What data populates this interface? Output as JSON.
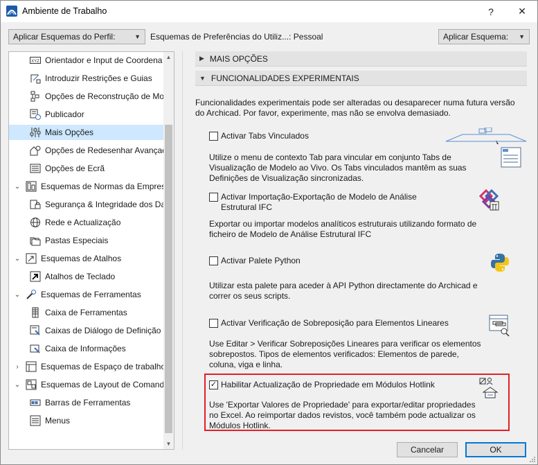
{
  "window": {
    "title": "Ambiente de Trabalho",
    "help_label": "?",
    "close_label": "✕"
  },
  "toolbar": {
    "apply_profile_label": "Aplicar Esquemas do Perfil:",
    "preference_schemes_label": "Esquemas de Preferências do Utiliz...:  Pessoal",
    "apply_scheme_label": "Aplicar Esquema:"
  },
  "tree": {
    "items": [
      {
        "label": "Orientador e Input de Coordena",
        "level": 2,
        "icon": "xyz-icon"
      },
      {
        "label": "Introduzir Restrições e Guias",
        "level": 2,
        "icon": "constraints-icon"
      },
      {
        "label": "Opções de Reconstrução de Mod",
        "level": 2,
        "icon": "rebuild-icon"
      },
      {
        "label": "Publicador",
        "level": 2,
        "icon": "publisher-icon"
      },
      {
        "label": "Mais Opções",
        "level": 2,
        "icon": "sliders-icon",
        "selected": true
      },
      {
        "label": "Opções de Redesenhar Avançada",
        "level": 2,
        "icon": "redraw-icon"
      },
      {
        "label": "Opções de Ecrã",
        "level": 2,
        "icon": "screen-icon"
      },
      {
        "label": "Esquemas de Normas da Empresa",
        "level": 1,
        "icon": "company-standards-icon",
        "expanded": true
      },
      {
        "label": "Segurança & Integridade dos Da",
        "level": 2,
        "icon": "security-icon"
      },
      {
        "label": "Rede e Actualização",
        "level": 2,
        "icon": "globe-icon"
      },
      {
        "label": "Pastas Especiais",
        "level": 2,
        "icon": "folders-icon"
      },
      {
        "label": "Esquemas de Atalhos",
        "level": 1,
        "icon": "shortcuts-icon",
        "expanded": true
      },
      {
        "label": "Atalhos de Teclado",
        "level": 2,
        "icon": "shortcut-arrow-icon"
      },
      {
        "label": "Esquemas de Ferramentas",
        "level": 1,
        "icon": "tools-icon",
        "expanded": true
      },
      {
        "label": "Caixa de Ferramentas",
        "level": 2,
        "icon": "toolbox-icon"
      },
      {
        "label": "Caixas de Diálogo de Definição d",
        "level": 2,
        "icon": "settings-dialog-icon"
      },
      {
        "label": "Caixa de Informações",
        "level": 2,
        "icon": "info-box-icon"
      },
      {
        "label": "Esquemas de Espaço de trabalho",
        "level": 1,
        "icon": "workspace-icon",
        "expanded": false
      },
      {
        "label": "Esquemas de Layout de Comandos",
        "level": 1,
        "icon": "command-layout-icon",
        "expanded": true
      },
      {
        "label": "Barras de Ferramentas",
        "level": 2,
        "icon": "toolbars-icon"
      },
      {
        "label": "Menus",
        "level": 2,
        "icon": "menus-icon"
      }
    ]
  },
  "sections": {
    "more_options": "MAIS OPÇÕES",
    "experimental": "FUNCIONALIDADES EXPERIMENTAIS"
  },
  "intro": "Funcionalidades experimentais pode ser alteradas ou desaparecer numa futura versão do Archicad. Por favor, experimente, mas não se envolva demasiado.",
  "features": [
    {
      "label": "Activar Tabs Vinculados",
      "checked": false,
      "description": "Utilize o menu de contexto Tab para vincular em conjunto Tabs de Visualização de Modelo ao Vivo. Os Tabs vinculados mantêm as suas Definições de Visualização sincronizadas.",
      "icon": "linked-tabs-icon"
    },
    {
      "label": "Activar Importação-Exportação de Modelo de Análise Estrutural IFC",
      "checked": false,
      "description": "Exportar ou importar modelos analíticos estruturais utilizando formato de ficheiro de Modelo de Análise Estrutural IFC",
      "icon": "ifc-structural-icon"
    },
    {
      "label": "Activar Palete Python",
      "checked": false,
      "description": "Utilizar esta palete para aceder à API Python directamente do Archicad e correr os seus scripts.",
      "icon": "python-icon"
    },
    {
      "label": "Activar Verificação de Sobreposição para Elementos Lineares",
      "checked": false,
      "description": "Use Editar > Verificar Sobreposições Lineares para verificar os elementos sobrepostos. Tipos de elementos verificados: Elementos de parede, coluna, viga e linha.",
      "icon": "overlap-check-icon"
    },
    {
      "label": "Habilitar Actualização de Propriedade em Módulos Hotlink",
      "checked": true,
      "description": "Use 'Exportar Valores de Propriedade' para exportar/editar propriedades no Excel. Ao reimportar dados revistos, você também pode actualizar os Módulos Hotlink.",
      "icon": "hotlink-property-icon"
    }
  ],
  "buttons": {
    "cancel": "Cancelar",
    "ok": "OK"
  },
  "colors": {
    "selection": "#cde8ff",
    "highlight": "#e21f26",
    "python_blue": "#3772a4",
    "python_yellow": "#f5c516",
    "ifc_pink": "#d1336e"
  }
}
